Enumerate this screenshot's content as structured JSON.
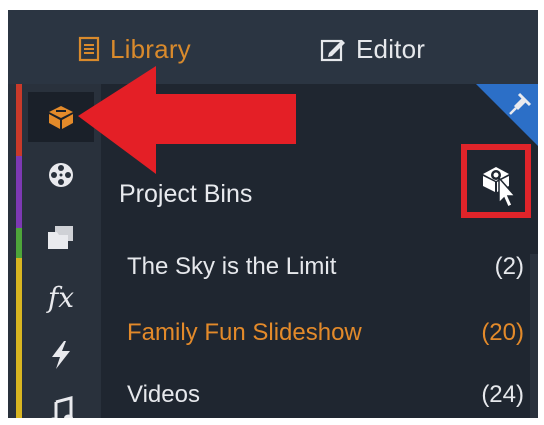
{
  "top_tabs": {
    "library_label": "Library",
    "editor_label": "Editor"
  },
  "panel": {
    "section_title": "Project Bins"
  },
  "bins": [
    {
      "name": "The Sky is the Limit",
      "count": "(2)",
      "selected": false
    },
    {
      "name": "Family Fun Slideshow",
      "count": "(20)",
      "selected": true
    },
    {
      "name": "Videos",
      "count": "(24)",
      "selected": false
    }
  ],
  "sidebar": {
    "items": [
      {
        "icon": "library-box-icon"
      },
      {
        "icon": "film-reel-icon"
      },
      {
        "icon": "folders-icon"
      },
      {
        "icon": "fx-icon",
        "text": "fx"
      },
      {
        "icon": "lightning-icon"
      },
      {
        "icon": "music-note-icon"
      }
    ]
  },
  "colors": {
    "accent_orange": "#d98a2c",
    "highlight_red": "#e0242a",
    "panel_bg": "#1f2630",
    "stripe_red": "#c93a2a",
    "stripe_purple": "#7d39b3",
    "stripe_green": "#4ea63a",
    "stripe_yellow": "#d8b521"
  }
}
